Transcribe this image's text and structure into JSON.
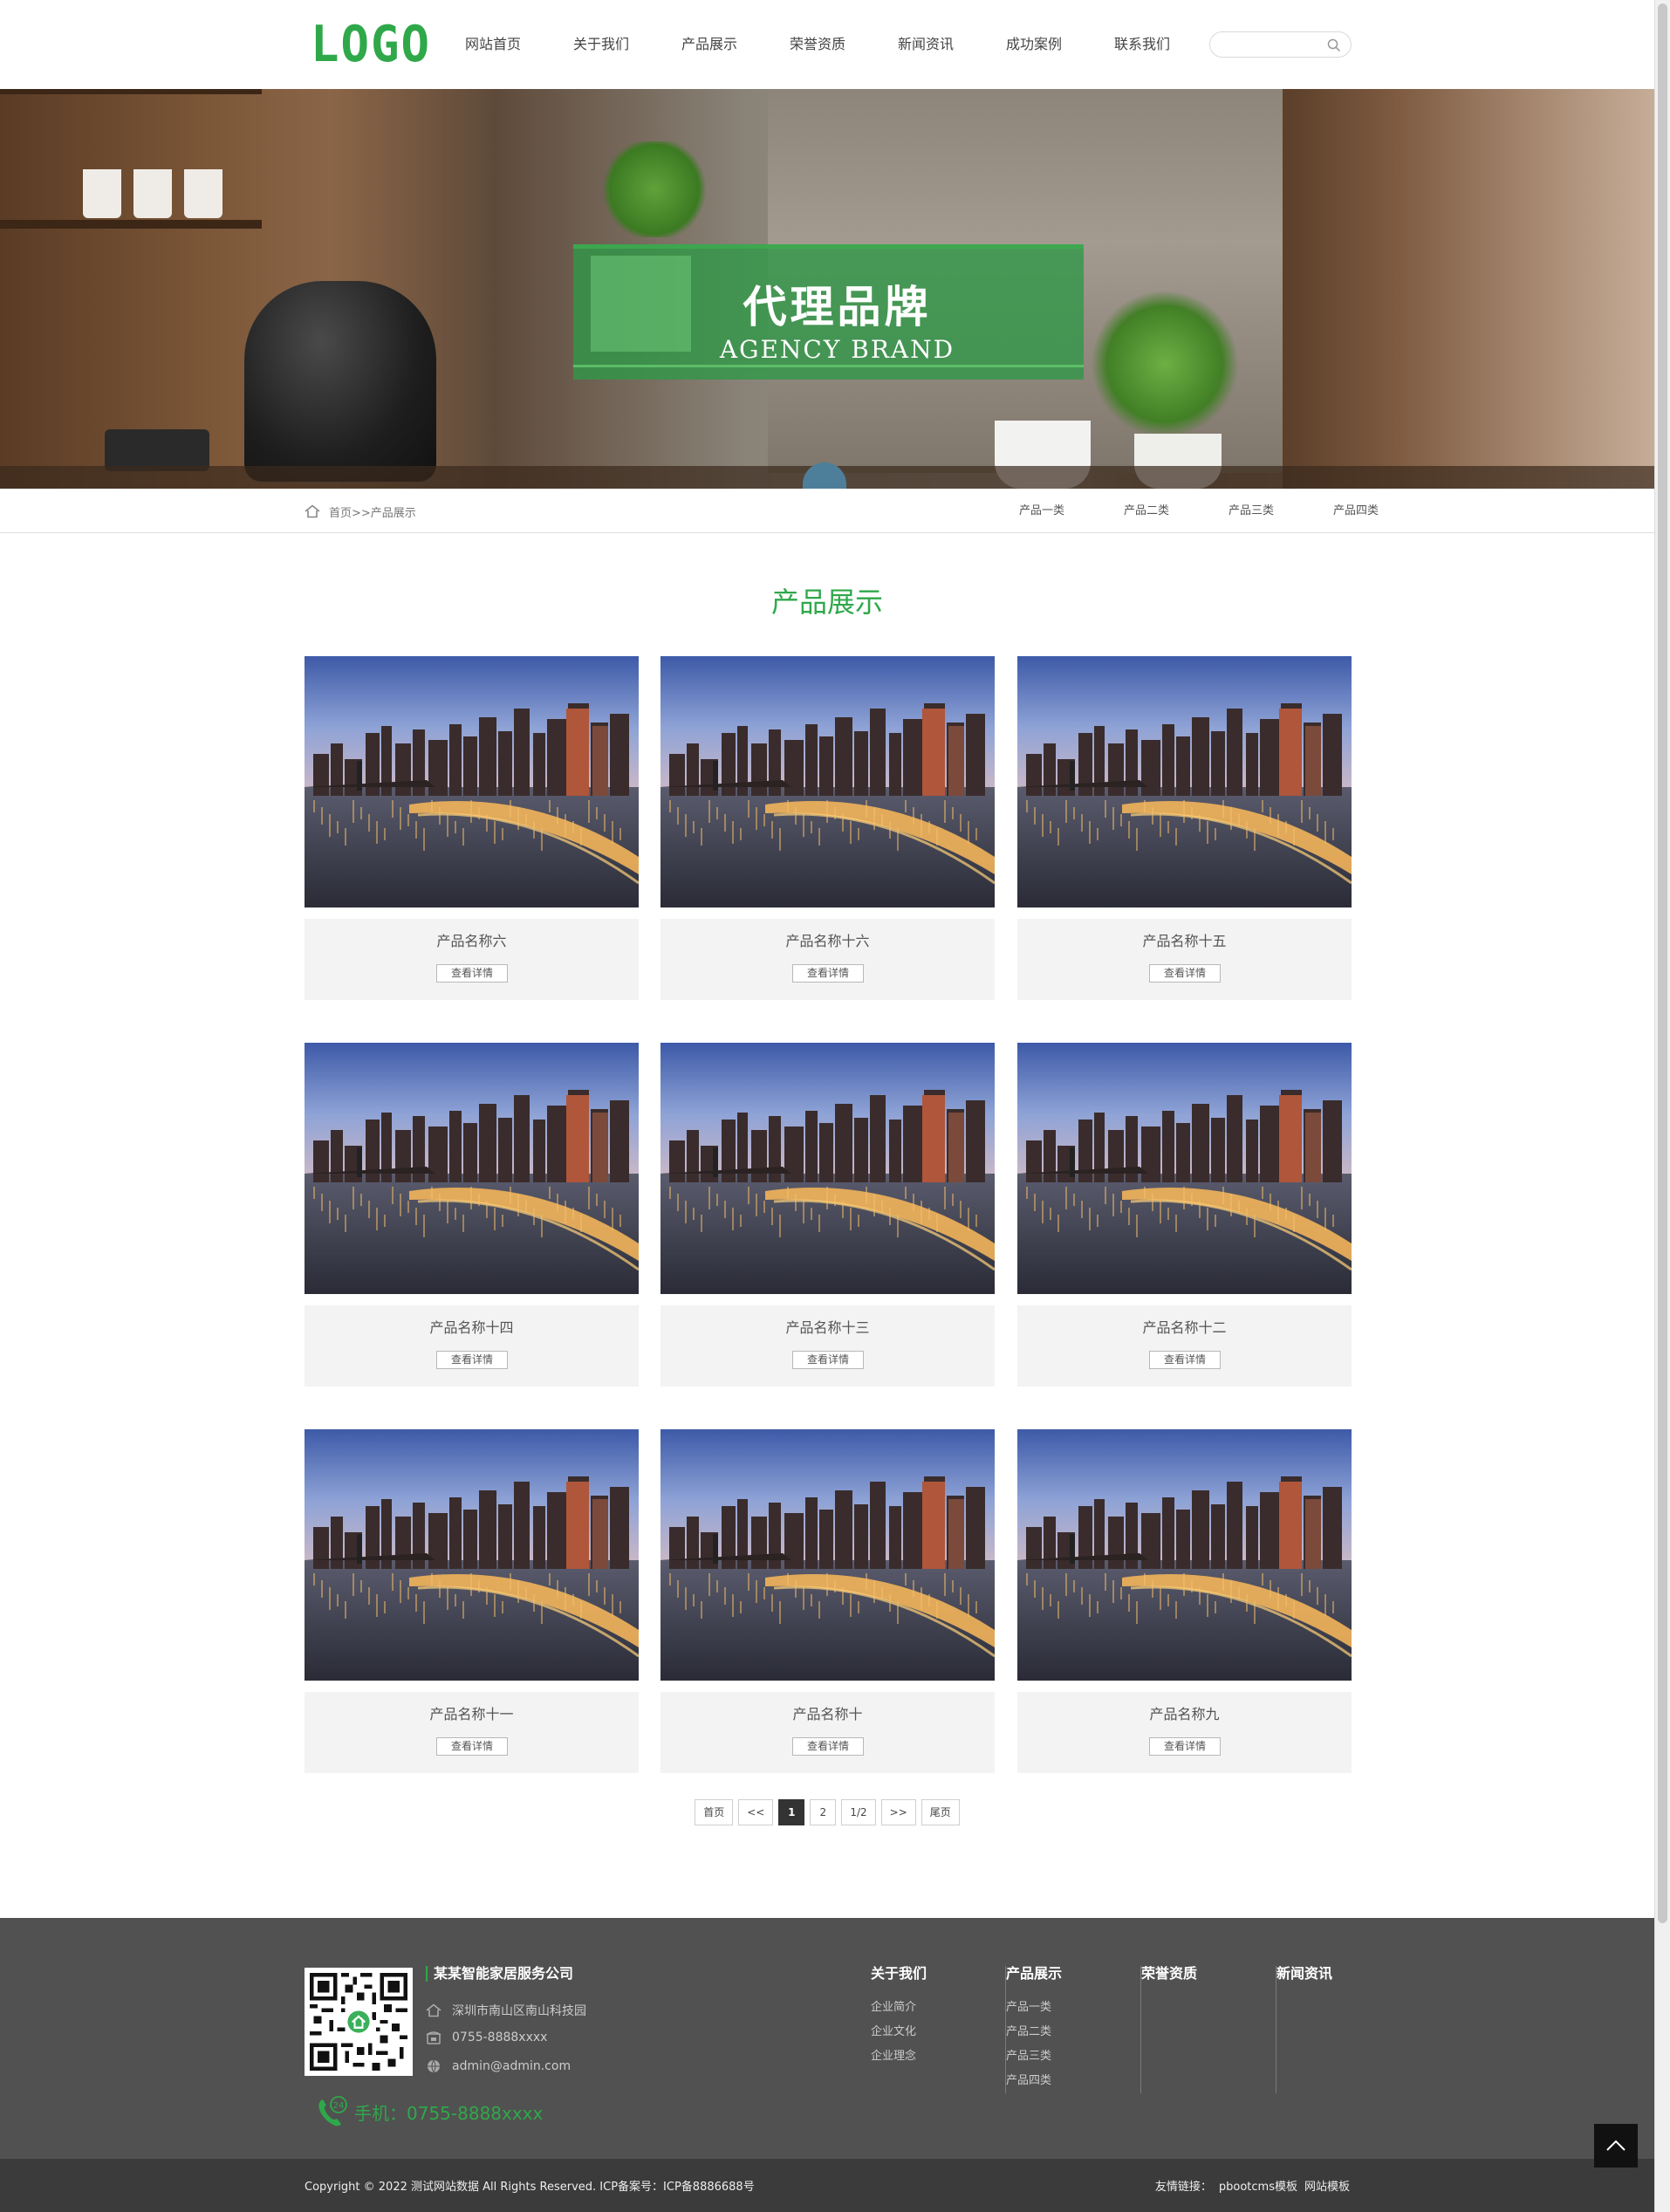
{
  "header": {
    "logo_text": "LOGO",
    "nav": [
      "网站首页",
      "关于我们",
      "产品展示",
      "荣誉资质",
      "新闻资讯",
      "成功案例",
      "联系我们"
    ],
    "search_placeholder": "",
    "accent_color": "#2fa84a"
  },
  "banner": {
    "title_cn": "代理品牌",
    "title_en": "AGENCY BRAND"
  },
  "breadcrumb": {
    "text": "首页>>产品展示",
    "subnav": [
      "产品一类",
      "产品二类",
      "产品三类",
      "产品四类"
    ]
  },
  "section": {
    "title": "产品展示"
  },
  "products": [
    {
      "name": "产品名称六",
      "button": "查看详情"
    },
    {
      "name": "产品名称十六",
      "button": "查看详情"
    },
    {
      "name": "产品名称十五",
      "button": "查看详情"
    },
    {
      "name": "产品名称十四",
      "button": "查看详情"
    },
    {
      "name": "产品名称十三",
      "button": "查看详情"
    },
    {
      "name": "产品名称十二",
      "button": "查看详情"
    },
    {
      "name": "产品名称十一",
      "button": "查看详情"
    },
    {
      "name": "产品名称十",
      "button": "查看详情"
    },
    {
      "name": "产品名称九",
      "button": "查看详情"
    }
  ],
  "pagination": {
    "first": "首页",
    "prev": "<<",
    "pages": [
      "1",
      "2"
    ],
    "current": "1",
    "status": "1/2",
    "next": ">>",
    "last": "尾页"
  },
  "footer": {
    "company": "某某智能家居服务公司",
    "address": "深圳市南山区南山科技园",
    "phone": "0755-8888xxxx",
    "email": "admin@admin.com",
    "mobile": "手机：0755-8888xxxx",
    "columns": [
      {
        "title": "关于我们",
        "items": [
          "企业简介",
          "企业文化",
          "企业理念"
        ]
      },
      {
        "title": "产品展示",
        "items": [
          "产品一类",
          "产品二类",
          "产品三类",
          "产品四类"
        ]
      },
      {
        "title": "荣誉资质",
        "items": []
      },
      {
        "title": "新闻资讯",
        "items": []
      }
    ],
    "copyright": "Copyright © 2022 测试网站数据 All Rights Reserved.   ICP备案号：ICP备8886688号",
    "links_label": "友情链接：",
    "links": [
      "pbootcms模板",
      "网站模板"
    ]
  }
}
